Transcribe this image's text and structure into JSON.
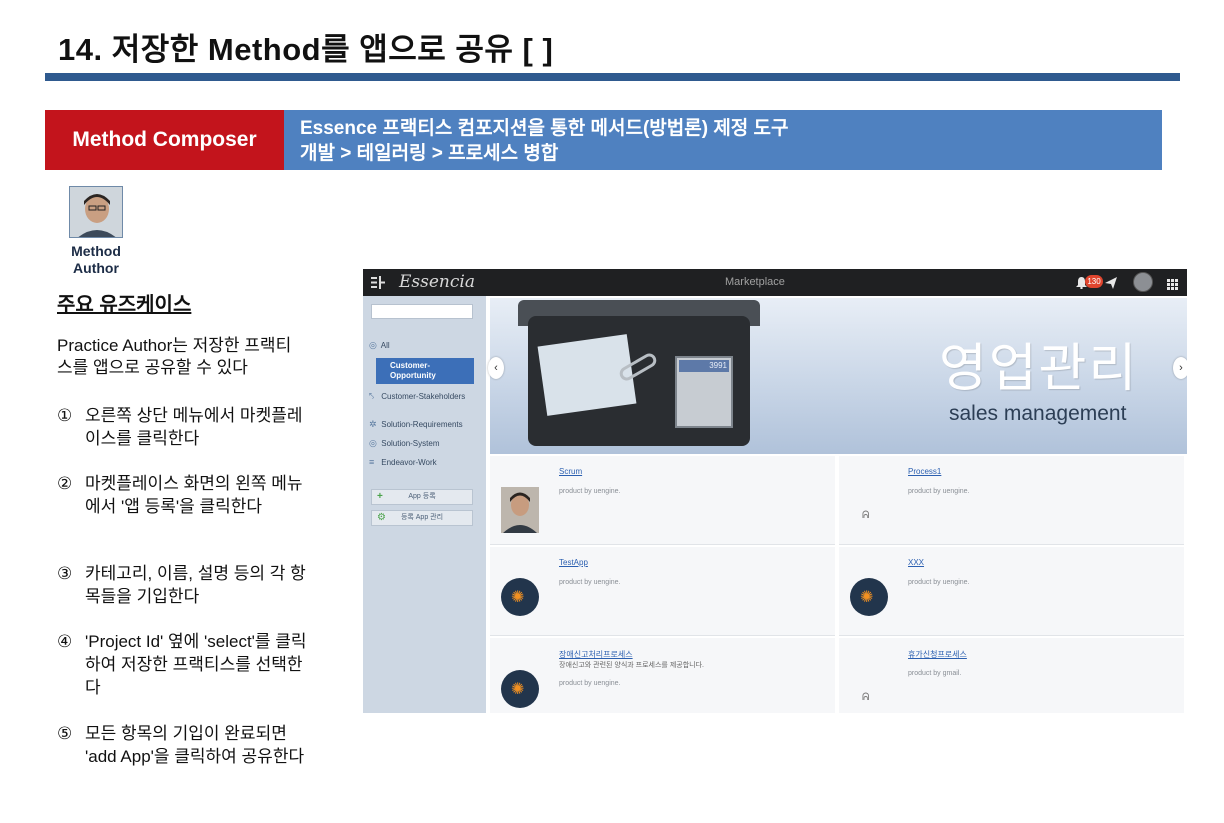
{
  "slide": {
    "title": "14. 저장한 Method를 앱으로 공유 [ ]",
    "banner": {
      "left_label": "Method Composer",
      "right_line1": "Essence 프랙티스 컴포지션을 통한 메서드(방법론) 제정 도구",
      "right_line2": "개발 > 테일러링 > 프로세스 병합"
    },
    "author": {
      "label_line1": "Method",
      "label_line2": "Author"
    },
    "usecase": {
      "heading": "주요 유즈케이스",
      "description": "Practice Author는 저장한 프랙티스를 앱으로 공유할 수 있다",
      "steps": [
        {
          "num": "①",
          "text": "오른쪽 상단 메뉴에서 마켓플레이스를 클릭한다"
        },
        {
          "num": "②",
          "text": "마켓플레이스 화면의 왼쪽 메뉴에서 '앱 등록'을 클릭한다"
        },
        {
          "num": "③",
          "text": "카테고리, 이름, 설명 등의 각 항목들을 기입한다"
        },
        {
          "num": "④",
          "text": "'Project Id' 옆에 'select'를 클릭하여 저장한 프랙티스를 선택한다"
        },
        {
          "num": "⑤",
          "text": "모든 항목의 기입이 완료되면 'add App'을 클릭하여 공유한다"
        }
      ]
    }
  },
  "app": {
    "brand": "Essencia",
    "page_title": "Marketplace",
    "notification_count": "130",
    "icons": {
      "menu": "menu-toggle-icon",
      "bell": "bell-icon",
      "send": "send-icon",
      "apps": "apps-grid-icon"
    },
    "sidebar": {
      "items": [
        {
          "label": "All",
          "icon": "◎",
          "active": false
        },
        {
          "label": "Customer-Opportunity",
          "icon": "",
          "active": true
        },
        {
          "label": "Customer-Stakeholders",
          "icon": "⤣",
          "active": false
        },
        {
          "label": "Solution-Requirements",
          "icon": "✲",
          "active": false
        },
        {
          "label": "Solution-System",
          "icon": "◎",
          "active": false
        },
        {
          "label": "Endeavor-Work",
          "icon": "≡",
          "active": false
        }
      ],
      "buttons": [
        {
          "label": "App 등록",
          "icon": "+"
        },
        {
          "label": "등록 App 관리",
          "icon": "⚙"
        }
      ]
    },
    "hero": {
      "title_ko": "영업관리",
      "title_en": "sales management",
      "calc_display": "3991"
    },
    "apps": [
      {
        "name": "Scrum",
        "description": "",
        "by": "product by uengine.",
        "thumb": "photo"
      },
      {
        "name": "Process1",
        "description": "",
        "by": "product by uengine.",
        "thumb": "placeholder"
      },
      {
        "name": "TestApp",
        "description": "",
        "by": "product by uengine.",
        "thumb": "gear"
      },
      {
        "name": "XXX",
        "description": "",
        "by": "product by uengine.",
        "thumb": "gear"
      },
      {
        "name": "장애신고처리프로세스",
        "description": "장애신고와 관련된 양식과 프로세스를 제공합니다.",
        "by": "product by uengine.",
        "thumb": "gear"
      },
      {
        "name": "휴가신청프로세스",
        "description": "",
        "by": "product by gmail.",
        "thumb": "placeholder"
      }
    ],
    "colors": {
      "title_rule": "#2f5a8f",
      "banner_red": "#c3141c",
      "banner_blue": "#4f81c0",
      "sidebar_bg": "#cdd7e3",
      "active_item": "#3c6fb8",
      "topbar": "#1f2022",
      "gear_accent": "#f29122"
    }
  }
}
